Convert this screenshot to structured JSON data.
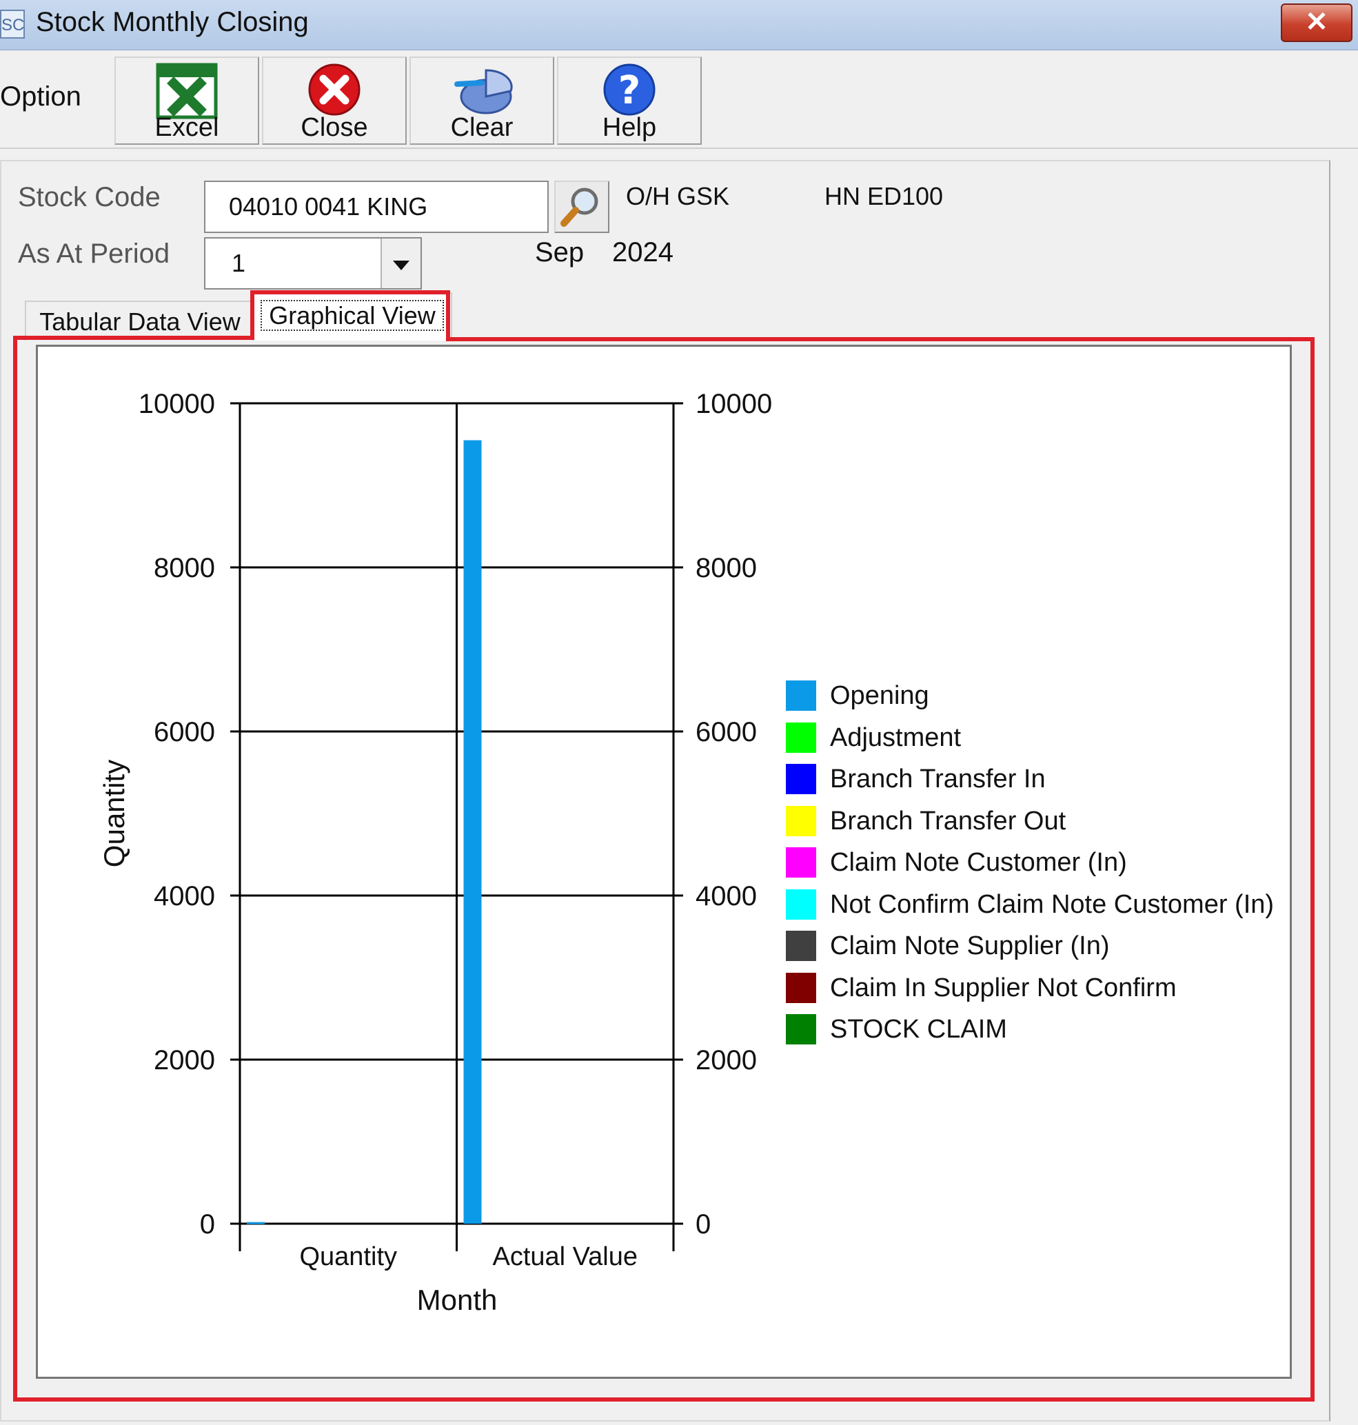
{
  "window": {
    "title": "Stock Monthly Closing",
    "icon_text": "SC",
    "close_glyph": "✕"
  },
  "toolbar": {
    "option_label": "Option",
    "buttons": [
      {
        "label": "Excel",
        "icon": "excel-icon"
      },
      {
        "label": "Close",
        "icon": "close-icon"
      },
      {
        "label": "Clear",
        "icon": "clear-icon"
      },
      {
        "label": "Help",
        "icon": "help-icon"
      }
    ]
  },
  "form": {
    "stock_code_label": "Stock Code",
    "stock_code_value": "04010 0041 KING",
    "as_at_period_label": "As At Period",
    "period_value": "1",
    "oh_text": "O/H GSK",
    "desc_text": "HN ED100",
    "month": "Sep",
    "year": "2024"
  },
  "tabs": [
    {
      "label": "Tabular Data View",
      "active": false
    },
    {
      "label": "Graphical View",
      "active": true
    }
  ],
  "chart_data": {
    "type": "bar",
    "xlabel": "Month",
    "ylabel": "Quantity",
    "categories": [
      "Quantity",
      "Actual Value"
    ],
    "ylim": [
      0,
      10000
    ],
    "y_ticks": [
      0,
      2000,
      4000,
      6000,
      8000,
      10000
    ],
    "secondary_y_ticks": [
      0,
      2000,
      4000,
      6000,
      8000,
      10000
    ],
    "grid": true,
    "legend_position": "right",
    "series": [
      {
        "name": "Opening",
        "color": "#0b9ae8",
        "values": [
          20,
          9550
        ]
      },
      {
        "name": "Adjustment",
        "color": "#00ff00",
        "values": [
          0,
          0
        ]
      },
      {
        "name": "Branch Transfer In",
        "color": "#0000ff",
        "values": [
          0,
          0
        ]
      },
      {
        "name": "Branch Transfer Out",
        "color": "#ffff00",
        "values": [
          0,
          0
        ]
      },
      {
        "name": "Claim Note Customer (In)",
        "color": "#ff00ff",
        "values": [
          0,
          0
        ]
      },
      {
        "name": "Not Confirm Claim Note Customer (In)",
        "color": "#00ffff",
        "values": [
          0,
          0
        ]
      },
      {
        "name": "Claim Note Supplier (In)",
        "color": "#404040",
        "values": [
          0,
          0
        ]
      },
      {
        "name": "Claim In Supplier Not Confirm",
        "color": "#800000",
        "values": [
          0,
          0
        ]
      },
      {
        "name": "STOCK CLAIM",
        "color": "#008000",
        "values": [
          0,
          0
        ]
      }
    ]
  }
}
